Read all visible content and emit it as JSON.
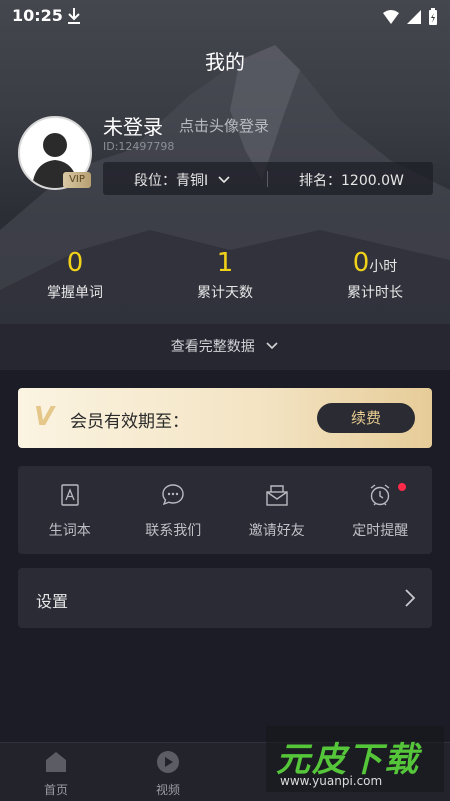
{
  "status": {
    "time": "10:25"
  },
  "page": {
    "title": "我的"
  },
  "profile": {
    "username": "未登录",
    "login_hint": "点击头像登录",
    "id_text": "ID:12497798",
    "vip_badge": "VIP",
    "rank_text": "段位：青铜I",
    "ranking_text": "排名：1200.0W"
  },
  "stats": [
    {
      "value": "0",
      "unit": "",
      "label": "掌握单词"
    },
    {
      "value": "1",
      "unit": "",
      "label": "累计天数"
    },
    {
      "value": "0",
      "unit": "小时",
      "label": "累计时长"
    }
  ],
  "view_full_data": "查看完整数据",
  "vip_card": {
    "logo": "V",
    "text": "会员有效期至：",
    "renew_label": "续费"
  },
  "quick_actions": [
    {
      "label": "生词本",
      "icon": "vocabulary-book-icon"
    },
    {
      "label": "联系我们",
      "icon": "chat-icon"
    },
    {
      "label": "邀请好友",
      "icon": "invite-mail-icon"
    },
    {
      "label": "定时提醒",
      "icon": "alarm-clock-icon",
      "notification_dot": true
    }
  ],
  "settings": {
    "label": "设置"
  },
  "tabbar": [
    {
      "label": "首页",
      "icon": "home-icon"
    },
    {
      "label": "视频",
      "icon": "play-icon"
    }
  ],
  "watermark": {
    "title": "元皮下载",
    "url": "www.yuanpi.com"
  },
  "colors": {
    "accent_yellow": "#f1d21a",
    "gold": "#e9cd91",
    "background": "#1b1c26",
    "card": "#2a2b35",
    "notification": "#ff2a4a"
  }
}
